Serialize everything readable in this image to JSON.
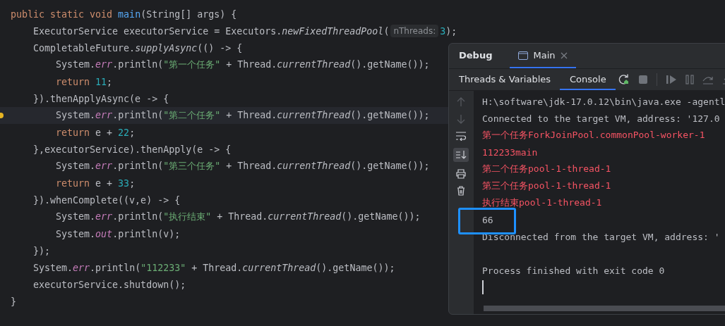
{
  "editor": {
    "lines": [
      {
        "highlighted": false,
        "tokens": [
          {
            "kind": "kw",
            "text": "public static void "
          },
          {
            "kind": "fn",
            "text": "main"
          },
          {
            "kind": "plain",
            "text": "(String[] args) {"
          }
        ]
      },
      {
        "highlighted": false,
        "tokens": [
          {
            "kind": "plain",
            "text": "    ExecutorService executorService = Executors."
          },
          {
            "kind": "static",
            "text": "newFixedThreadPool"
          },
          {
            "kind": "plain",
            "text": "("
          },
          {
            "kind": "hint",
            "text": "nThreads:"
          },
          {
            "kind": "num",
            "text": "3"
          },
          {
            "kind": "plain",
            "text": ");"
          }
        ]
      },
      {
        "highlighted": false,
        "tokens": [
          {
            "kind": "plain",
            "text": "    CompletableFuture."
          },
          {
            "kind": "static",
            "text": "supplyAsync"
          },
          {
            "kind": "plain",
            "text": "(() -> {"
          }
        ]
      },
      {
        "highlighted": false,
        "tokens": [
          {
            "kind": "plain",
            "text": "        System."
          },
          {
            "kind": "field",
            "text": "err"
          },
          {
            "kind": "plain",
            "text": ".println("
          },
          {
            "kind": "str",
            "text": "\"第一个任务\""
          },
          {
            "kind": "plain",
            "text": " + Thread."
          },
          {
            "kind": "static",
            "text": "currentThread"
          },
          {
            "kind": "plain",
            "text": "().getName());"
          }
        ]
      },
      {
        "highlighted": false,
        "tokens": [
          {
            "kind": "kw",
            "text": "        return"
          },
          {
            "kind": "num",
            "text": " 11"
          },
          {
            "kind": "plain",
            "text": ";"
          }
        ]
      },
      {
        "highlighted": false,
        "tokens": [
          {
            "kind": "plain",
            "text": "    }).thenApplyAsync(e -> {"
          }
        ]
      },
      {
        "highlighted": true,
        "tokens": [
          {
            "kind": "plain",
            "text": "        System."
          },
          {
            "kind": "field",
            "text": "err"
          },
          {
            "kind": "plain",
            "text": ".println("
          },
          {
            "kind": "str",
            "text": "\"第二个任务\""
          },
          {
            "kind": "plain",
            "text": " + Thread."
          },
          {
            "kind": "static",
            "text": "currentThread"
          },
          {
            "kind": "plain",
            "text": "().getName());"
          }
        ]
      },
      {
        "highlighted": false,
        "tokens": [
          {
            "kind": "kw",
            "text": "        return"
          },
          {
            "kind": "plain",
            "text": " e + "
          },
          {
            "kind": "num",
            "text": "22"
          },
          {
            "kind": "plain",
            "text": ";"
          }
        ]
      },
      {
        "highlighted": false,
        "tokens": [
          {
            "kind": "plain",
            "text": "    },executorService).thenApply(e -> {"
          }
        ]
      },
      {
        "highlighted": false,
        "tokens": [
          {
            "kind": "plain",
            "text": "        System."
          },
          {
            "kind": "field",
            "text": "err"
          },
          {
            "kind": "plain",
            "text": ".println("
          },
          {
            "kind": "str",
            "text": "\"第三个任务\""
          },
          {
            "kind": "plain",
            "text": " + Thread."
          },
          {
            "kind": "static",
            "text": "currentThread"
          },
          {
            "kind": "plain",
            "text": "().getName());"
          }
        ]
      },
      {
        "highlighted": false,
        "tokens": [
          {
            "kind": "kw",
            "text": "        return"
          },
          {
            "kind": "plain",
            "text": " e + "
          },
          {
            "kind": "num",
            "text": "33"
          },
          {
            "kind": "plain",
            "text": ";"
          }
        ]
      },
      {
        "highlighted": false,
        "tokens": [
          {
            "kind": "plain",
            "text": "    }).whenComplete((v,e) -> {"
          }
        ]
      },
      {
        "highlighted": false,
        "tokens": [
          {
            "kind": "plain",
            "text": "        System."
          },
          {
            "kind": "field",
            "text": "err"
          },
          {
            "kind": "plain",
            "text": ".println("
          },
          {
            "kind": "str",
            "text": "\"执行结束\""
          },
          {
            "kind": "plain",
            "text": " + Thread."
          },
          {
            "kind": "static",
            "text": "currentThread"
          },
          {
            "kind": "plain",
            "text": "().getName());"
          }
        ]
      },
      {
        "highlighted": false,
        "tokens": [
          {
            "kind": "plain",
            "text": "        System."
          },
          {
            "kind": "field",
            "text": "out"
          },
          {
            "kind": "plain",
            "text": ".println(v);"
          }
        ]
      },
      {
        "highlighted": false,
        "tokens": [
          {
            "kind": "plain",
            "text": "    });"
          }
        ]
      },
      {
        "highlighted": false,
        "tokens": [
          {
            "kind": "plain",
            "text": "    System."
          },
          {
            "kind": "field",
            "text": "err"
          },
          {
            "kind": "plain",
            "text": ".println("
          },
          {
            "kind": "str",
            "text": "\"112233\""
          },
          {
            "kind": "plain",
            "text": " + Thread."
          },
          {
            "kind": "static",
            "text": "currentThread"
          },
          {
            "kind": "plain",
            "text": "().getName());"
          }
        ]
      },
      {
        "highlighted": false,
        "tokens": [
          {
            "kind": "plain",
            "text": "    executorService.shutdown();"
          }
        ]
      },
      {
        "highlighted": false,
        "tokens": [
          {
            "kind": "plain",
            "text": "}"
          }
        ]
      }
    ]
  },
  "debug_panel": {
    "title_tabs": [
      {
        "label": "Debug",
        "selected": false,
        "closable": false
      },
      {
        "label": "Main",
        "selected": true,
        "closable": true
      }
    ],
    "tabs": [
      {
        "label": "Threads & Variables",
        "selected": false
      },
      {
        "label": "Console",
        "selected": true
      }
    ],
    "console_lines": [
      {
        "kind": "out",
        "text": "H:\\software\\jdk-17.0.12\\bin\\java.exe -agentl"
      },
      {
        "kind": "out",
        "text": "Connected to the target VM, address: '127.0"
      },
      {
        "kind": "err",
        "text": "第一个任务ForkJoinPool.commonPool-worker-1"
      },
      {
        "kind": "err",
        "text": "112233main"
      },
      {
        "kind": "err",
        "text": "第二个任务pool-1-thread-1"
      },
      {
        "kind": "err",
        "text": "第三个任务pool-1-thread-1"
      },
      {
        "kind": "err",
        "text": "执行结束pool-1-thread-1"
      },
      {
        "kind": "out",
        "text": "66"
      },
      {
        "kind": "out",
        "text": "Disconnected from the target VM, address: '"
      },
      {
        "kind": "blank"
      },
      {
        "kind": "out",
        "text": "Process finished with exit code 0"
      },
      {
        "kind": "caret"
      }
    ]
  }
}
